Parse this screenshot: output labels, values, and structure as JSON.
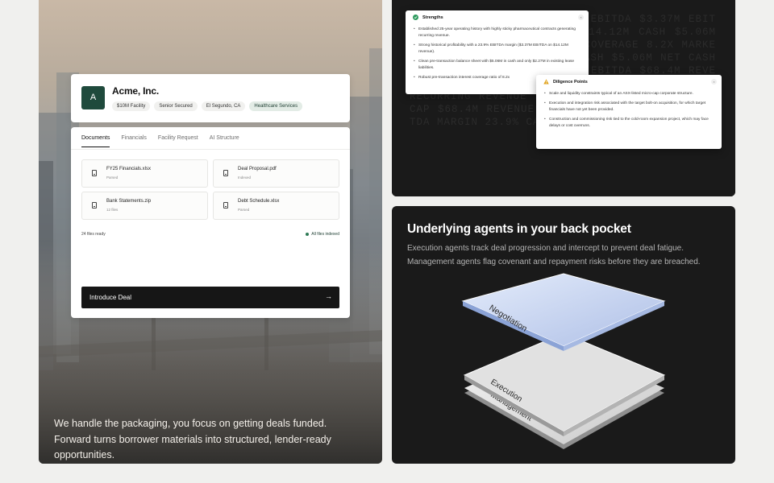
{
  "left": {
    "caption": "We handle the packaging, you focus on getting deals funded. Forward turns borrower materials into structured, lender-ready opportunities.",
    "deal": {
      "avatar_letter": "A",
      "company": "Acme, Inc.",
      "tags": [
        "$10M Facility",
        "Senior Secured",
        "El Segundo, CA",
        "Healthcare Services"
      ]
    },
    "tabs": [
      "Documents",
      "Financials",
      "Facility Request",
      "AI Structure"
    ],
    "files": [
      {
        "name": "FY25 Financials.xlsx",
        "status": "Parsed"
      },
      {
        "name": "Deal Proposal.pdf",
        "status": "Indexed"
      },
      {
        "name": "Bank Statements.zip",
        "status": "12 files"
      },
      {
        "name": "Debt Schedule.xlsx",
        "status": "Parsed"
      }
    ],
    "files_ready": "24 files ready",
    "all_indexed": "All files indexed",
    "cta_label": "Introduce Deal"
  },
  "top_right": {
    "ticker_text": "RECURRING REVENUE $14.12M EBITDA $3.37M EBITDA MARGIN 23.9% REVENUE $14.12M CASH $5.06M NET CASH $68.4M INTEREST COVERAGE 8.2X MARKET CAP RECURRING REVENUE CASH $5.06M NET CASH 92% RECURRING REVENUE 92% EBITDA $68.4M REVENUE $14.12M NET CASH $5.06M NET CASH EBITDA RECURRING REVENUE 92% 6.7 EBITDA 6.7X MARKET CAP $68.4M REVENUE $14.12M EBITDA $3.37M EBITDA MARGIN 23.9% CASH",
    "strengths": {
      "title": "Strengths",
      "items": [
        "Established 25-year operating history with highly sticky pharmaceutical contracts generating recurring revenue.",
        "Strong historical profitability with a 23.9% EBITDA margin ($3.37M EBITDA on $14.12M revenue).",
        "Clean pre-transaction balance sheet with $5.06M in cash and only $2.27M in existing lease liabilities.",
        "Robust pre-transaction interest coverage ratio of 8.2x"
      ]
    },
    "diligence": {
      "title": "Diligence Points",
      "items": [
        "Scale and liquidity constraints typical of an ASX-listed micro-cap corporate structure.",
        "Execution and integration risk associated with the target bolt-on acquisition, for which target financials have not yet been provided.",
        "Construction and commissioning risk tied to the cold-room expansion project, which may face delays or cost overruns."
      ]
    },
    "colors": {
      "strength_accent": "#2e9a5e",
      "diligence_accent": "#e0a21b"
    }
  },
  "bottom_right": {
    "title": "Underlying agents in your back pocket",
    "body": "Execution agents track deal progression and intercept to prevent deal fatigue. Management agents flag covenant and repayment risks before they are breached.",
    "plate_labels": [
      "Negotiation",
      "Execution",
      "Management"
    ]
  }
}
